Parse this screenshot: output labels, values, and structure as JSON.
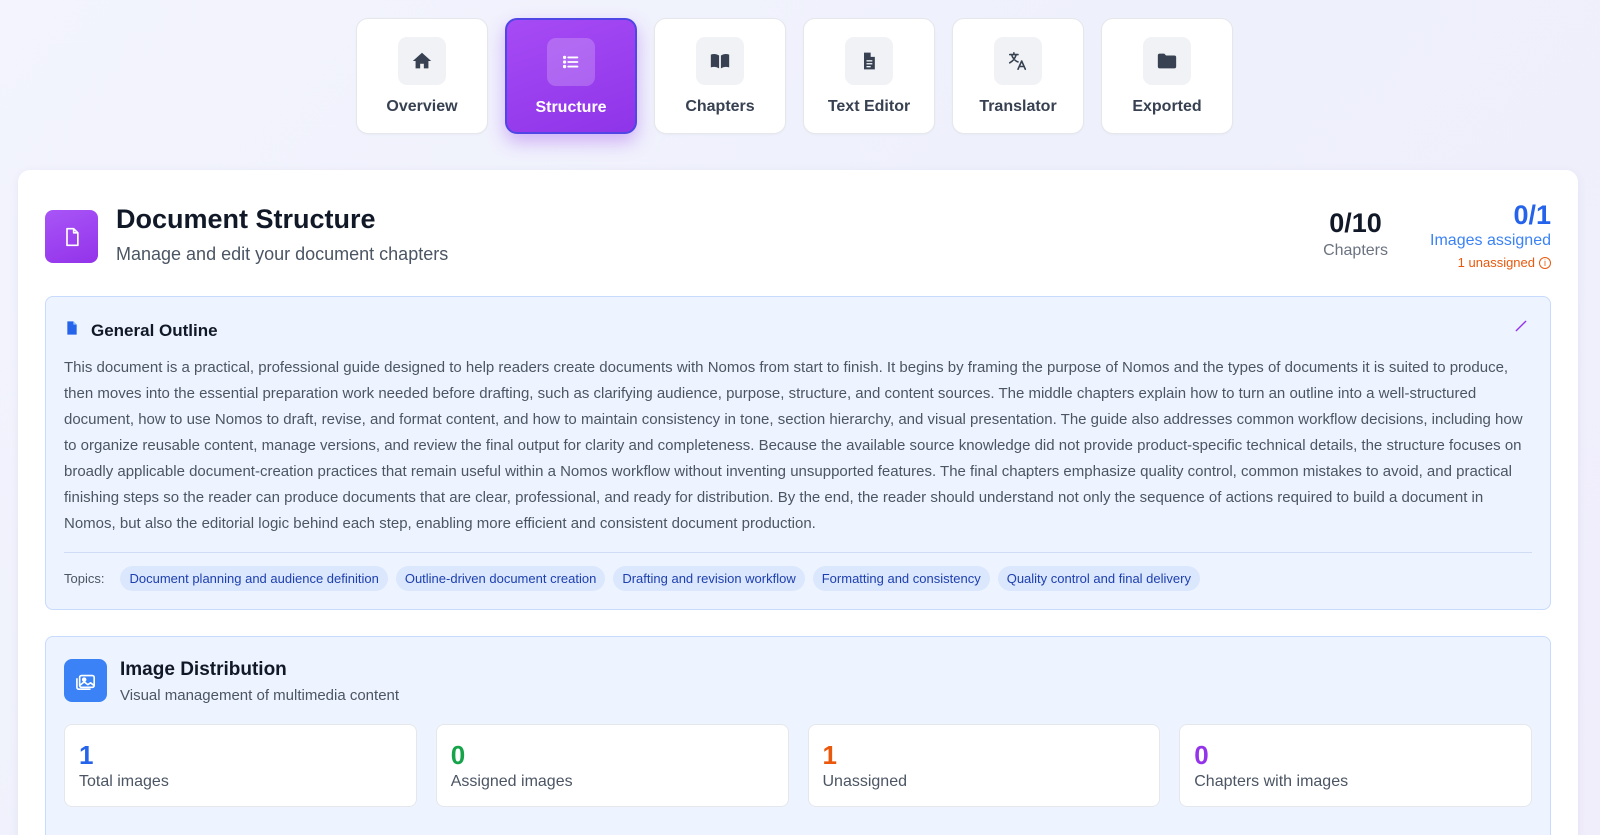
{
  "tabs": [
    {
      "label": "Overview",
      "icon": "home-icon",
      "active": false
    },
    {
      "label": "Structure",
      "icon": "list-icon",
      "active": true
    },
    {
      "label": "Chapters",
      "icon": "book-icon",
      "active": false
    },
    {
      "label": "Text Editor",
      "icon": "file-text-icon",
      "active": false
    },
    {
      "label": "Translator",
      "icon": "translate-icon",
      "active": false
    },
    {
      "label": "Exported",
      "icon": "folder-icon",
      "active": false
    }
  ],
  "header": {
    "title": "Document Structure",
    "subtitle": "Manage and edit your document chapters",
    "chapters_stat": {
      "value": "0/10",
      "label": "Chapters"
    },
    "images_stat": {
      "value": "0/1",
      "label": "Images assigned",
      "warning": "1 unassigned"
    }
  },
  "outline": {
    "title": "General Outline",
    "text": "This document is a practical, professional guide designed to help readers create documents with Nomos from start to finish. It begins by framing the purpose of Nomos and the types of documents it is suited to produce, then moves into the essential preparation work needed before drafting, such as clarifying audience, purpose, structure, and content sources. The middle chapters explain how to turn an outline into a well-structured document, how to use Nomos to draft, revise, and format content, and how to maintain consistency in tone, section hierarchy, and visual presentation. The guide also addresses common workflow decisions, including how to organize reusable content, manage versions, and review the final output for clarity and completeness. Because the available source knowledge did not provide product-specific technical details, the structure focuses on broadly applicable document-creation practices that remain useful within a Nomos workflow without inventing unsupported features. The final chapters emphasize quality control, common mistakes to avoid, and practical finishing steps so the reader can produce documents that are clear, professional, and ready for distribution. By the end, the reader should understand not only the sequence of actions required to build a document in Nomos, but also the editorial logic behind each step, enabling more efficient and consistent document production.",
    "topics_label": "Topics:",
    "topics": [
      "Document planning and audience definition",
      "Outline-driven document creation",
      "Drafting and revision workflow",
      "Formatting and consistency",
      "Quality control and final delivery"
    ]
  },
  "distribution": {
    "title": "Image Distribution",
    "subtitle": "Visual management of multimedia content",
    "cards": [
      {
        "value": "1",
        "label": "Total images",
        "color": "#2563eb"
      },
      {
        "value": "0",
        "label": "Assigned images",
        "color": "#16a34a"
      },
      {
        "value": "1",
        "label": "Unassigned",
        "color": "#ea580c"
      },
      {
        "value": "0",
        "label": "Chapters with images",
        "color": "#9333ea"
      }
    ]
  },
  "colors": {
    "accent": "#9333ea",
    "accent_border": "#4f46e5",
    "info_blue": "#2563eb",
    "warning_orange": "#ea580c"
  }
}
